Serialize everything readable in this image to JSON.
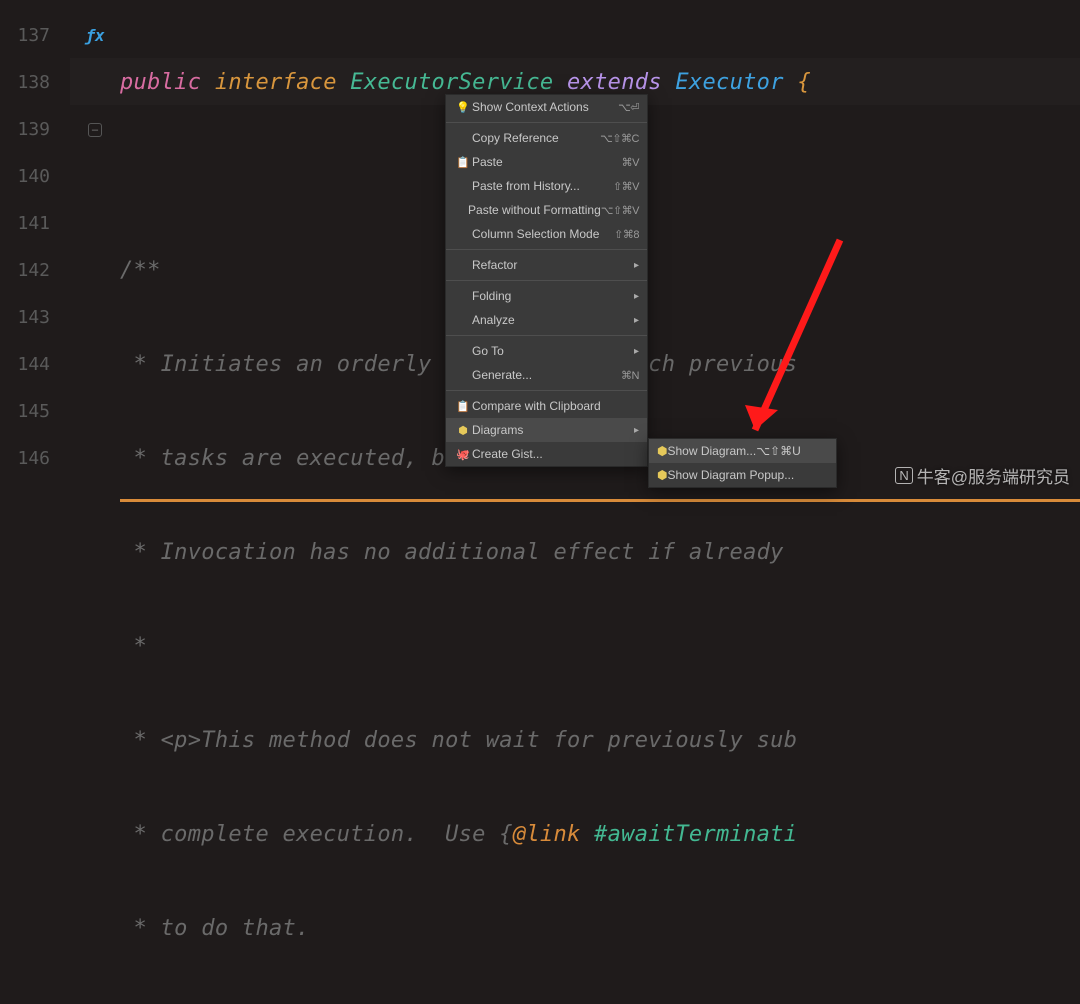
{
  "lines": {
    "n137": "137",
    "n138": "138",
    "n139": "139",
    "n140": "140",
    "n141": "141",
    "n142": "142",
    "n143": "143",
    "n144": "144",
    "n145": "145",
    "n146": "146"
  },
  "code": {
    "l137": {
      "public": "public",
      "interface": "interface",
      "svc": "ExecutorService",
      "extends": "extends",
      "exec": "Executor",
      "brace": "{"
    },
    "l139": "/**",
    "l140": " * Initiates an orderly shutdown in which previous",
    "l141": " * tasks are executed, but no new tasks will be ac",
    "l142": " * Invocation has no additional effect if already ",
    "l143": " *",
    "l144": " * <p>This method does not wait for previously sub",
    "l145_a": " * complete execution.  Use ",
    "l145_link": "@link",
    "l145_ref": "#awaitTerminati",
    "l146": " * to do that."
  },
  "menu": {
    "show_context_actions": "Show Context Actions",
    "show_context_actions_key": "⌥⏎",
    "copy_reference": "Copy Reference",
    "copy_reference_key": "⌥⇧⌘C",
    "paste": "Paste",
    "paste_key": "⌘V",
    "paste_history": "Paste from History...",
    "paste_history_key": "⇧⌘V",
    "paste_plain": "Paste without Formatting",
    "paste_plain_key": "⌥⇧⌘V",
    "column_mode": "Column Selection Mode",
    "column_mode_key": "⇧⌘8",
    "refactor": "Refactor",
    "folding": "Folding",
    "analyze": "Analyze",
    "goto": "Go To",
    "generate": "Generate...",
    "generate_key": "⌘N",
    "compare_clip": "Compare with Clipboard",
    "diagrams": "Diagrams",
    "create_gist": "Create Gist..."
  },
  "submenu": {
    "show_diagram": "Show Diagram...",
    "show_diagram_key": "⌥⇧⌘U",
    "show_diagram_popup": "Show Diagram Popup..."
  },
  "watermark": "牛客@服务端研究员"
}
